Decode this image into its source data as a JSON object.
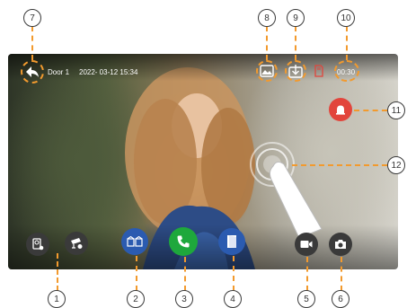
{
  "header": {
    "door_label": "Door 1",
    "datetime": "2022- 03-12 15:34",
    "timer": "00:30"
  },
  "callouts": [
    "1",
    "2",
    "3",
    "4",
    "5",
    "6",
    "7",
    "8",
    "9",
    "10",
    "11",
    "12"
  ],
  "icons": {
    "back": "back-arrow-icon",
    "snapshot_gallery": "gallery-icon",
    "download": "download-icon",
    "recording": "sd-card-icon",
    "alarm": "alarm-icon",
    "touch": "touch-gesture-icon",
    "monitor": "monitor-switch-icon",
    "camera_switch": "cctv-camera-icon",
    "intercom": "intercom-icon",
    "answer": "phone-icon",
    "unlock": "door-unlock-icon",
    "video": "video-record-icon",
    "photo": "camera-icon"
  },
  "colors": {
    "callout": "#f29a2e",
    "blue_button": "#2b5bb0",
    "green_button": "#1ea83c",
    "alarm_button": "#e2453c"
  }
}
